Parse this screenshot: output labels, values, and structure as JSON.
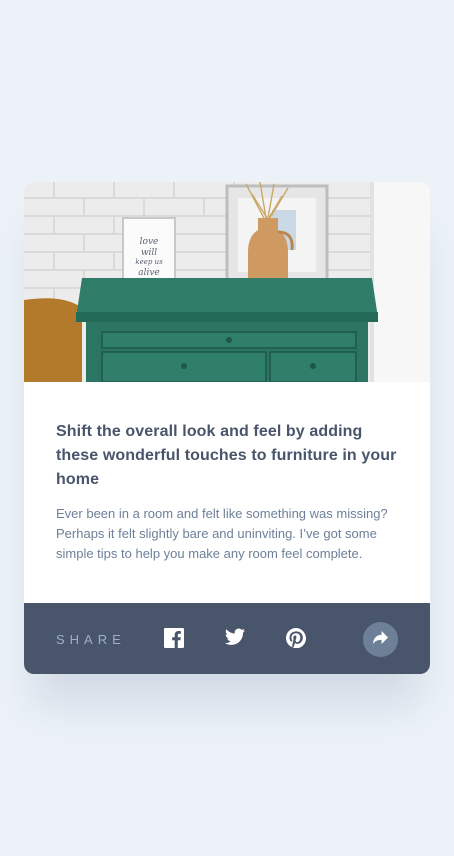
{
  "article": {
    "title": "Shift the overall look and feel by adding these wonderful touches to furniture in your home",
    "description": "Ever been in a room and felt like something was missing? Perhaps it felt slightly bare and uninviting. I’ve got some simple tips to help you make any room feel complete.",
    "image_frame_text": "love will keep us alive"
  },
  "share": {
    "label": "SHARE",
    "networks": [
      "facebook-icon",
      "twitter-icon",
      "pinterest-icon"
    ],
    "button_icon": "share-icon"
  },
  "colors": {
    "background": "#ecf2f8",
    "title": "#48556a",
    "body_text": "#6e8098",
    "share_bar": "#48556a",
    "share_label": "#9eafc2",
    "share_button": "#6e8098",
    "dresser_green": "#2e7a66"
  }
}
